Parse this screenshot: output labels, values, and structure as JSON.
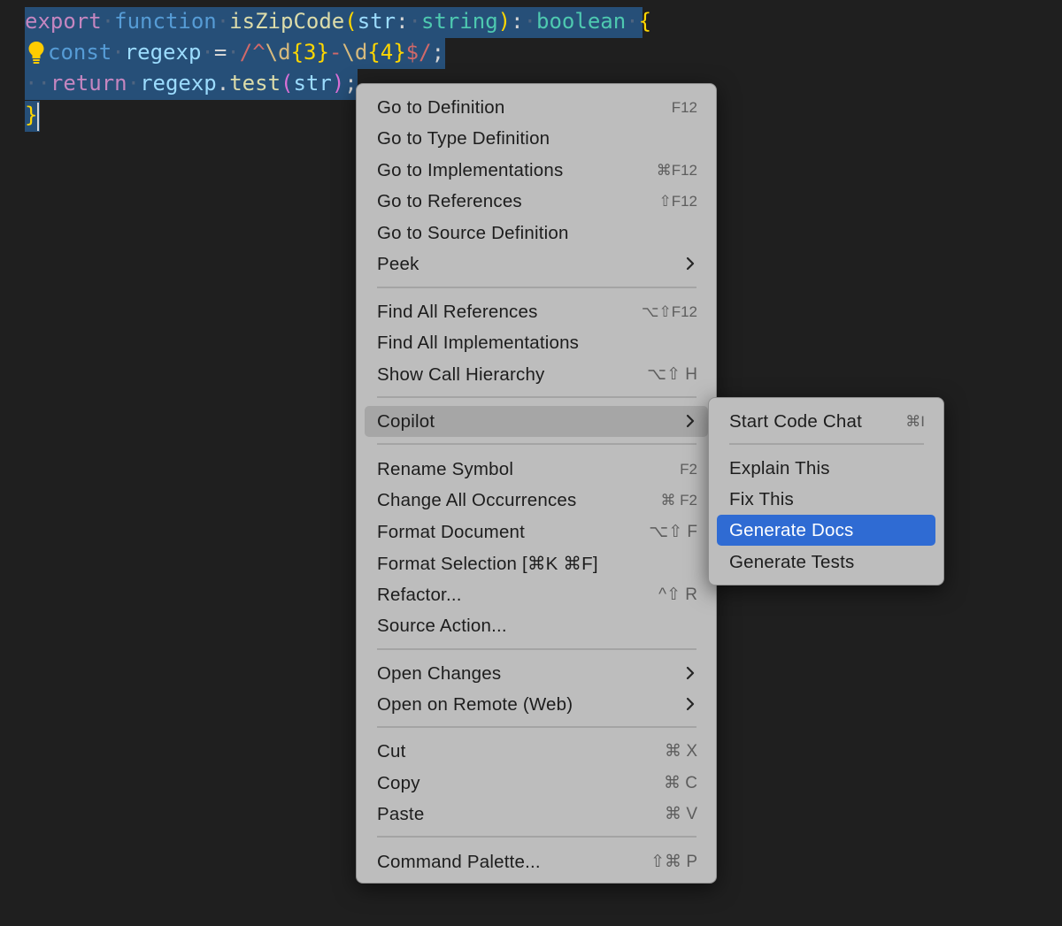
{
  "code": {
    "line1": {
      "export_kw": "export",
      "function_kw": "function",
      "fn_name": "isZipCode",
      "param": "str",
      "param_type": "string",
      "return_type": "boolean"
    },
    "line2": {
      "const_kw": "const",
      "var_name": "regexp",
      "regex_open": "/^",
      "regex_d1": "\\d",
      "regex_q1": "{3}",
      "regex_dash": "-",
      "regex_d2": "\\d",
      "regex_q2": "{4}",
      "regex_close": "$/"
    },
    "line3": {
      "return_kw": "return",
      "obj": "regexp",
      "method": "test",
      "arg": "str"
    }
  },
  "context_menu": {
    "items": [
      {
        "label": "Go to Definition",
        "shortcut": "F12"
      },
      {
        "label": "Go to Type Definition",
        "shortcut": ""
      },
      {
        "label": "Go to Implementations",
        "shortcut": "⌘F12"
      },
      {
        "label": "Go to References",
        "shortcut": "⇧F12"
      },
      {
        "label": "Go to Source Definition",
        "shortcut": ""
      },
      {
        "label": "Peek",
        "shortcut": ""
      },
      {
        "label": "Find All References",
        "shortcut": "⌥⇧F12"
      },
      {
        "label": "Find All Implementations",
        "shortcut": ""
      },
      {
        "label": "Show Call Hierarchy",
        "shortcut": "⌥⇧ H"
      },
      {
        "label": "Copilot",
        "shortcut": ""
      },
      {
        "label": "Rename Symbol",
        "shortcut": "F2"
      },
      {
        "label": "Change All Occurrences",
        "shortcut": "⌘ F2"
      },
      {
        "label": "Format Document",
        "shortcut": "⌥⇧ F"
      },
      {
        "label": "Format Selection [⌘K ⌘F]",
        "shortcut": ""
      },
      {
        "label": "Refactor...",
        "shortcut": "^⇧ R"
      },
      {
        "label": "Source Action...",
        "shortcut": ""
      },
      {
        "label": "Open Changes",
        "shortcut": ""
      },
      {
        "label": "Open on Remote (Web)",
        "shortcut": ""
      },
      {
        "label": "Cut",
        "shortcut": "⌘ X"
      },
      {
        "label": "Copy",
        "shortcut": "⌘ C"
      },
      {
        "label": "Paste",
        "shortcut": "⌘ V"
      },
      {
        "label": "Command Palette...",
        "shortcut": "⇧⌘ P"
      }
    ]
  },
  "copilot_submenu": {
    "items": [
      {
        "label": "Start Code Chat",
        "shortcut": "⌘I"
      },
      {
        "label": "Explain This",
        "shortcut": ""
      },
      {
        "label": "Fix This",
        "shortcut": ""
      },
      {
        "label": "Generate Docs",
        "shortcut": ""
      },
      {
        "label": "Generate Tests",
        "shortcut": ""
      }
    ]
  },
  "colors": {
    "editor_bg": "#1f1f1f",
    "selection": "#264f78",
    "menu_bg": "#bdbdbd",
    "hover_bg": "#a6a6a6",
    "active_bg": "#2f6bd3"
  },
  "icons": {
    "lightbulb": "lightbulb-icon",
    "submenu_arrow": "chevron-right-icon"
  }
}
